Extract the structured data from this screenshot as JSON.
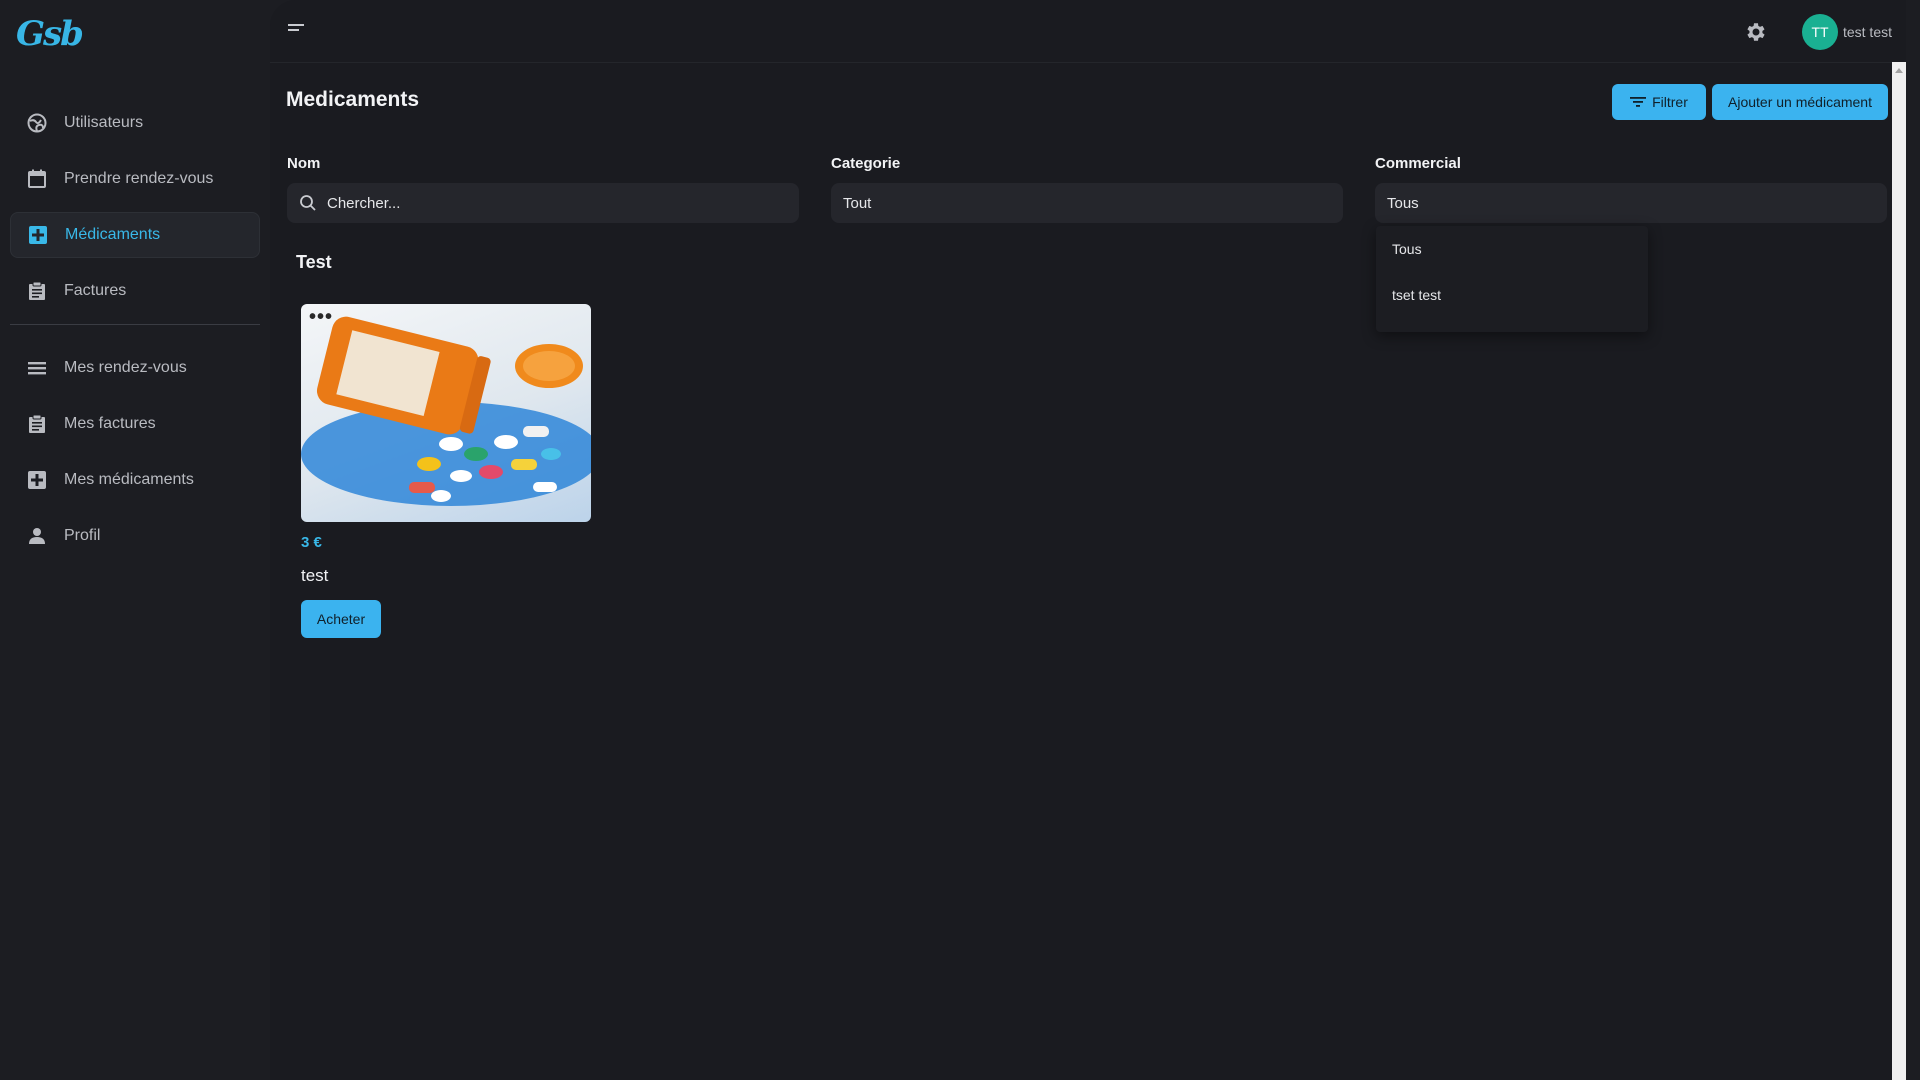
{
  "app": {
    "logo_text": "Gsb"
  },
  "sidebar": {
    "items": [
      {
        "label": "Utilisateurs",
        "icon": "globe-icon",
        "active": false
      },
      {
        "label": "Prendre rendez-vous",
        "icon": "calendar-icon",
        "active": false
      },
      {
        "label": "Médicaments",
        "icon": "medical-cross-icon",
        "active": true
      },
      {
        "label": "Factures",
        "icon": "clipboard-icon",
        "active": false
      }
    ],
    "items2": [
      {
        "label": "Mes rendez-vous",
        "icon": "list-icon"
      },
      {
        "label": "Mes factures",
        "icon": "clipboard-icon"
      },
      {
        "label": "Mes médicaments",
        "icon": "medical-cross-icon"
      },
      {
        "label": "Profil",
        "icon": "person-icon"
      }
    ]
  },
  "header": {
    "avatar_initials": "TT",
    "username": "test test"
  },
  "page": {
    "title": "Medicaments",
    "filter_button": "Filtrer",
    "add_button": "Ajouter un médicament"
  },
  "filters": {
    "name_label": "Nom",
    "name_placeholder": "Chercher...",
    "category_label": "Categorie",
    "category_value": "Tout",
    "commercial_label": "Commercial",
    "commercial_value": "Tous",
    "commercial_options": [
      "Tous",
      "tset test"
    ]
  },
  "section": {
    "title": "Test"
  },
  "product": {
    "price": "3 €",
    "name": "test",
    "buy_button": "Acheter"
  },
  "colors": {
    "accent": "#3bb3ef",
    "avatar": "#1ab092",
    "background": "#1a1b20"
  }
}
